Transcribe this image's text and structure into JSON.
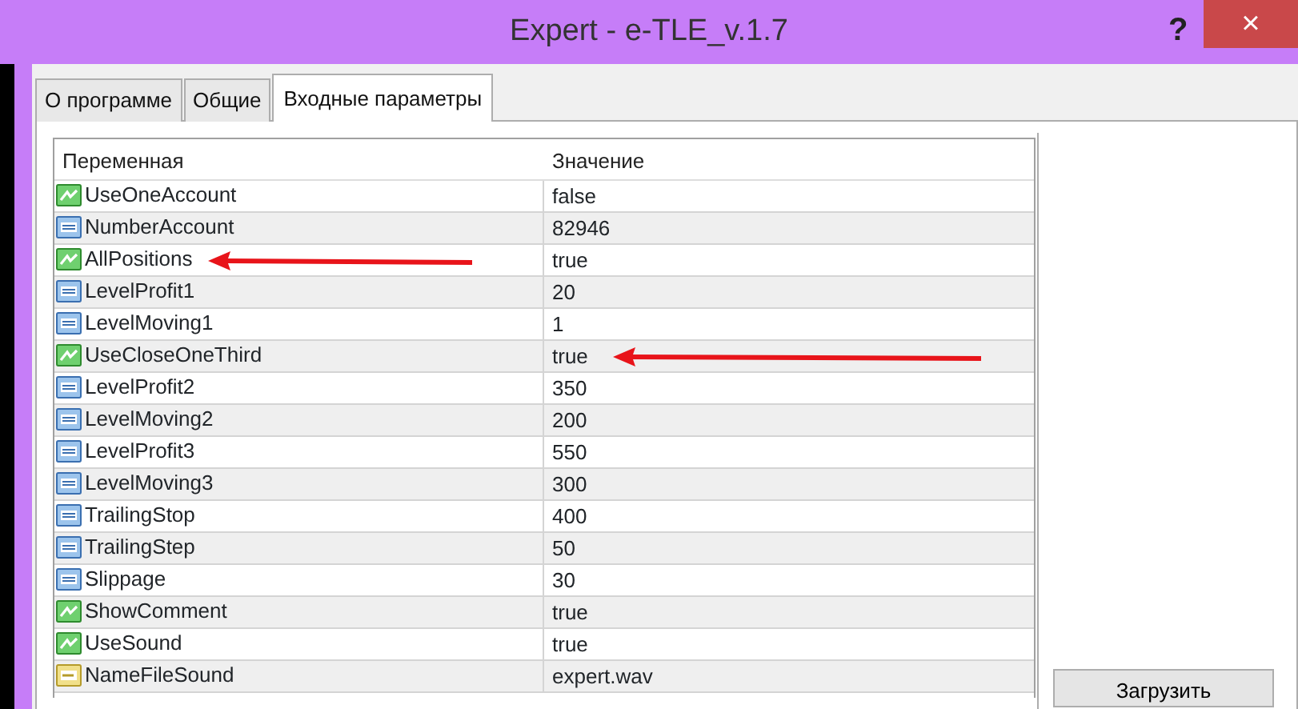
{
  "window": {
    "title": "Expert - e-TLE_v.1.7",
    "help": "?",
    "close": "×"
  },
  "tabs": [
    {
      "label": "О программе",
      "selected": false
    },
    {
      "label": "Общие",
      "selected": false
    },
    {
      "label": "Входные параметры",
      "selected": true
    }
  ],
  "table": {
    "columns": [
      "Переменная",
      "Значение"
    ],
    "rows": [
      {
        "kind": "bool",
        "name": "UseOneAccount",
        "value": "false"
      },
      {
        "kind": "int",
        "name": "NumberAccount",
        "value": "82946"
      },
      {
        "kind": "bool",
        "name": "AllPositions",
        "value": "true",
        "arrow": true
      },
      {
        "kind": "int",
        "name": "LevelProfit1",
        "value": "20"
      },
      {
        "kind": "int",
        "name": "LevelMoving1",
        "value": "1"
      },
      {
        "kind": "bool",
        "name": "UseCloseOneThird",
        "value": "true",
        "arrow": true
      },
      {
        "kind": "int",
        "name": "LevelProfit2",
        "value": "350"
      },
      {
        "kind": "int",
        "name": "LevelMoving2",
        "value": "200"
      },
      {
        "kind": "int",
        "name": "LevelProfit3",
        "value": "550"
      },
      {
        "kind": "int",
        "name": "LevelMoving3",
        "value": "300"
      },
      {
        "kind": "int",
        "name": "TrailingStop",
        "value": "400"
      },
      {
        "kind": "int",
        "name": "TrailingStep",
        "value": "50"
      },
      {
        "kind": "int",
        "name": "Slippage",
        "value": "30"
      },
      {
        "kind": "bool",
        "name": "ShowComment",
        "value": "true"
      },
      {
        "kind": "bool",
        "name": "UseSound",
        "value": "true"
      },
      {
        "kind": "string",
        "name": "NameFileSound",
        "value": "expert.wav"
      }
    ]
  },
  "buttons": [
    "Загрузить"
  ]
}
